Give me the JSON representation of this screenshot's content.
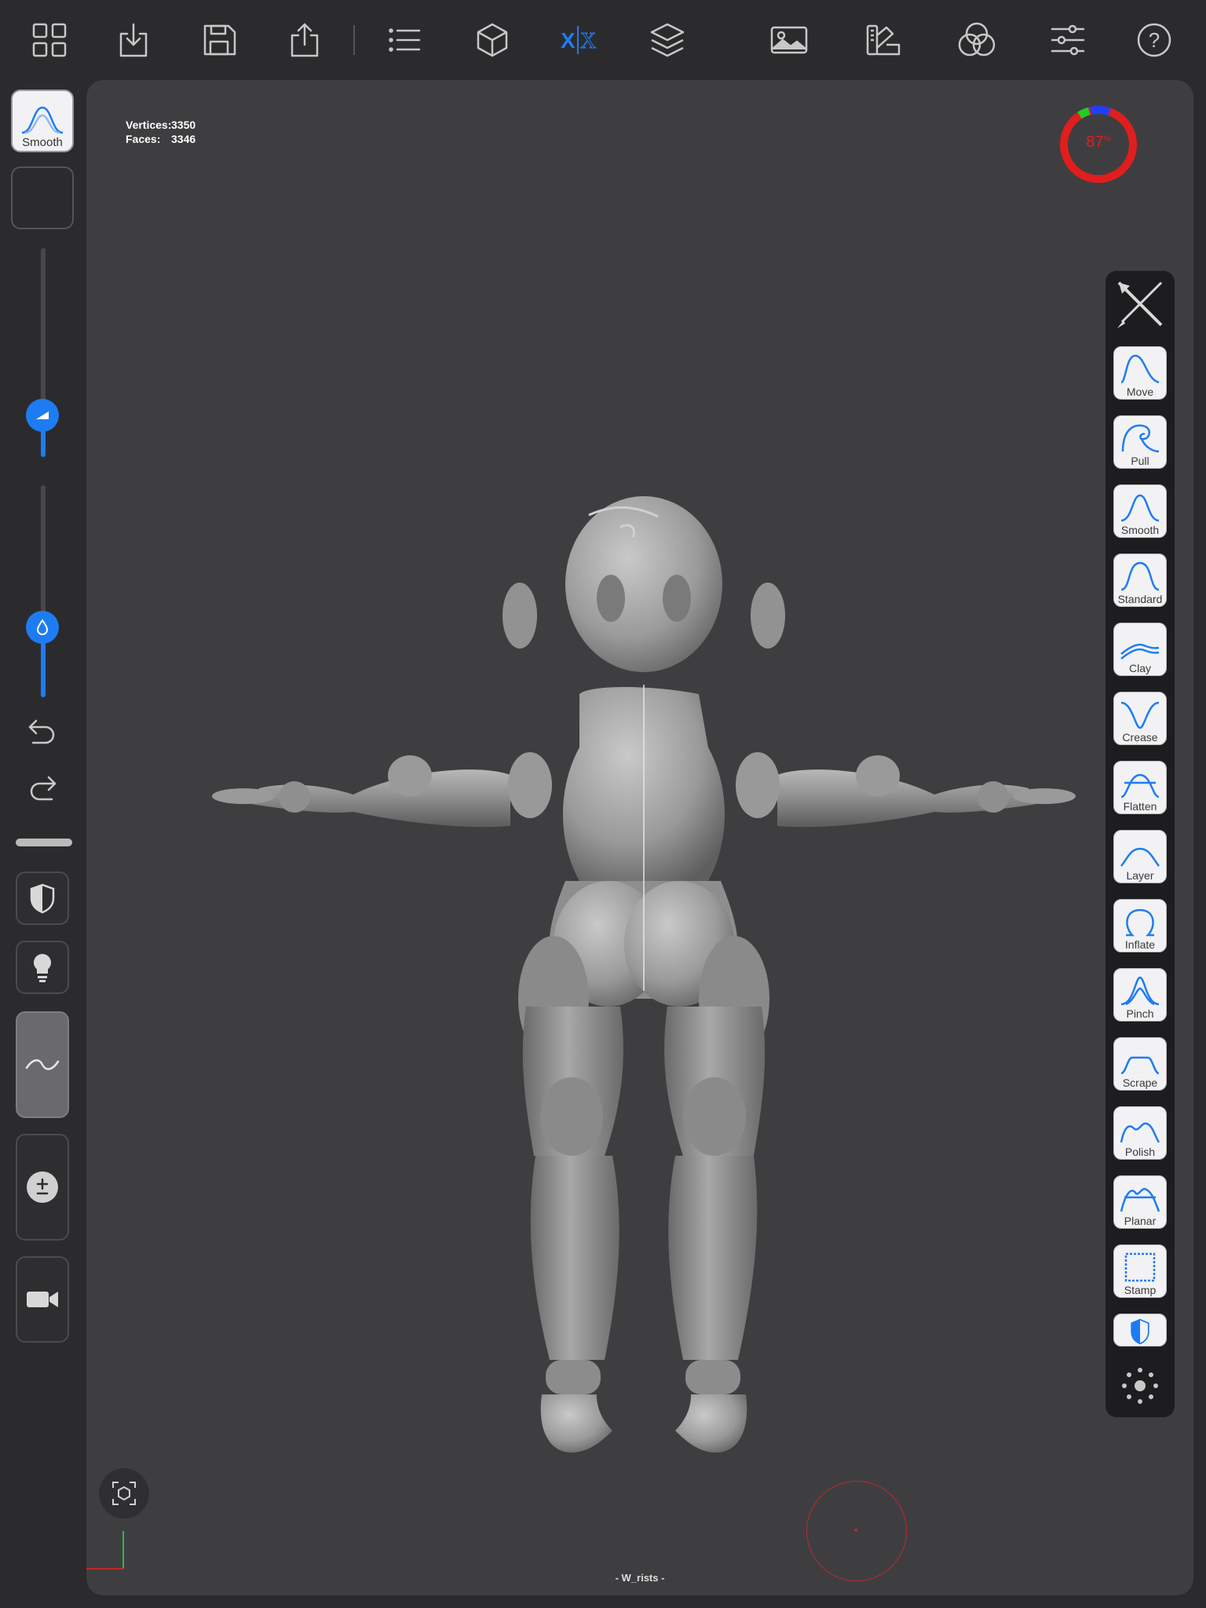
{
  "toolbar": {
    "icons": [
      "grid-icon",
      "download-icon",
      "save-icon",
      "share-icon",
      "list-icon",
      "cube-icon",
      "symmetry-icon",
      "layers-icon",
      "image-icon",
      "palette-icon",
      "rgb-icon",
      "sliders-icon",
      "help-icon"
    ],
    "symmetry_label_left": "X",
    "symmetry_label_right": "X",
    "help_label": "?"
  },
  "stats": {
    "vertices_label": "Vertices:",
    "vertices_value": "3350",
    "faces_label": "Faces:",
    "faces_value": "3346"
  },
  "memory": {
    "percent_label": "87",
    "percent_sign": "%",
    "percent": 87,
    "colors": [
      "#e01e1e",
      "#1e40ff",
      "#22cc22"
    ]
  },
  "left_panel": {
    "active_tool_label": "Smooth",
    "size_slider": 0.2,
    "intensity_slider": 0.33,
    "accent_color": "#1e7cf2"
  },
  "tools": [
    {
      "label": "Move"
    },
    {
      "label": "Pull"
    },
    {
      "label": "Smooth"
    },
    {
      "label": "Standard"
    },
    {
      "label": "Clay"
    },
    {
      "label": "Crease"
    },
    {
      "label": "Flatten"
    },
    {
      "label": "Layer"
    },
    {
      "label": "Inflate"
    },
    {
      "label": "Pinch"
    },
    {
      "label": "Scrape"
    },
    {
      "label": "Polish"
    },
    {
      "label": "Planar"
    },
    {
      "label": "Stamp"
    }
  ],
  "viewport": {
    "bottom_label": "- W_rists -",
    "background": "#3e3e40"
  }
}
